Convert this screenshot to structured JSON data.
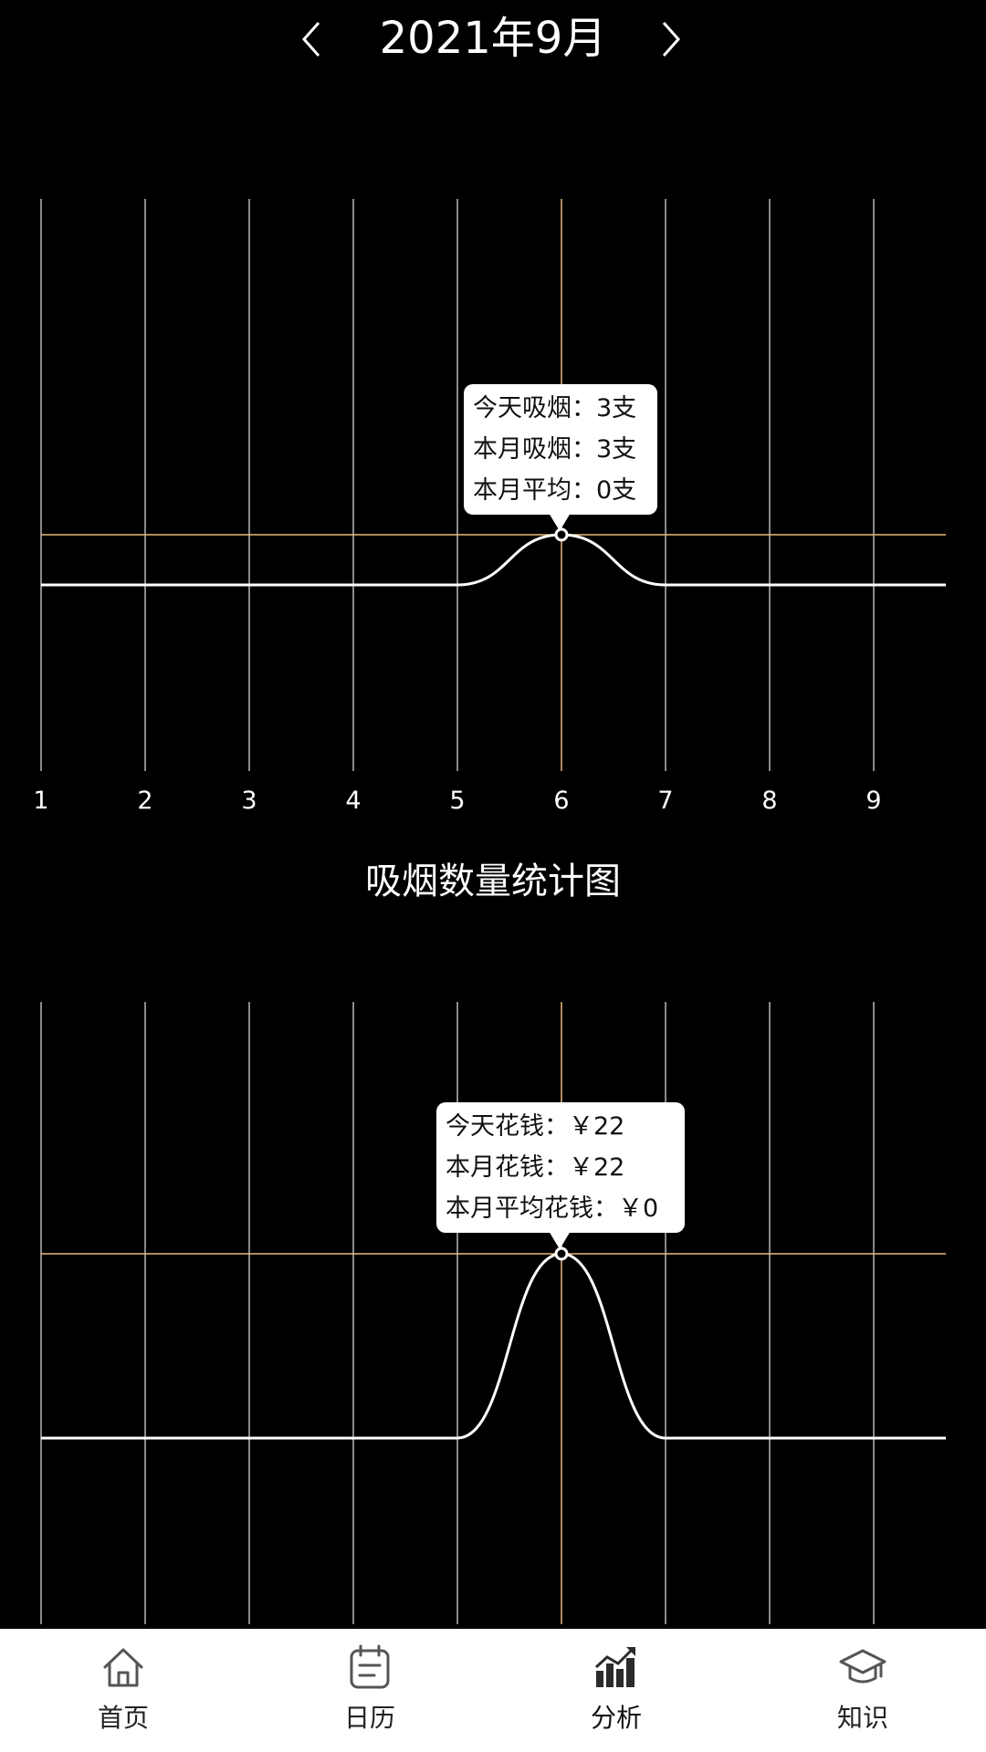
{
  "header": {
    "title": "2021年9月",
    "prev_icon": "chevron-left-icon",
    "next_icon": "chevron-right-icon"
  },
  "colors": {
    "background": "#000000",
    "grid": "#8a8a8a",
    "highlight": "#e8b77a",
    "curve": "#ffffff",
    "tab_background": "#ffffff"
  },
  "chart_data": [
    {
      "type": "line",
      "x": [
        1,
        2,
        3,
        4,
        5,
        6,
        7,
        8,
        9
      ],
      "x_tick_labels": [
        "1",
        "2",
        "3",
        "4",
        "5",
        "6",
        "7",
        "8",
        "9"
      ],
      "series": [
        {
          "values": [
            0,
            0,
            0,
            0,
            0,
            3,
            0,
            0,
            0
          ]
        }
      ],
      "ylim": [
        0,
        3
      ],
      "highlight_x": 6,
      "grid": "vertical",
      "title": "吸烟数量统计图",
      "tooltip": [
        "今天吸烟：3支",
        "本月吸烟：3支",
        "本月平均：0支"
      ]
    },
    {
      "type": "line",
      "x": [
        1,
        2,
        3,
        4,
        5,
        6,
        7,
        8,
        9
      ],
      "series": [
        {
          "values": [
            0,
            0,
            0,
            0,
            0,
            22,
            0,
            0,
            0
          ]
        }
      ],
      "ylim": [
        0,
        22
      ],
      "highlight_x": 6,
      "grid": "vertical",
      "tooltip": [
        "今天花钱：￥22",
        "本月花钱：￥22",
        "本月平均花钱：￥0"
      ]
    }
  ],
  "tabbar": {
    "items": [
      {
        "label": "首页",
        "icon": "home-icon"
      },
      {
        "label": "日历",
        "icon": "calendar-icon"
      },
      {
        "label": "分析",
        "icon": "chart-icon",
        "active": true
      },
      {
        "label": "知识",
        "icon": "graduation-cap-icon"
      }
    ]
  }
}
